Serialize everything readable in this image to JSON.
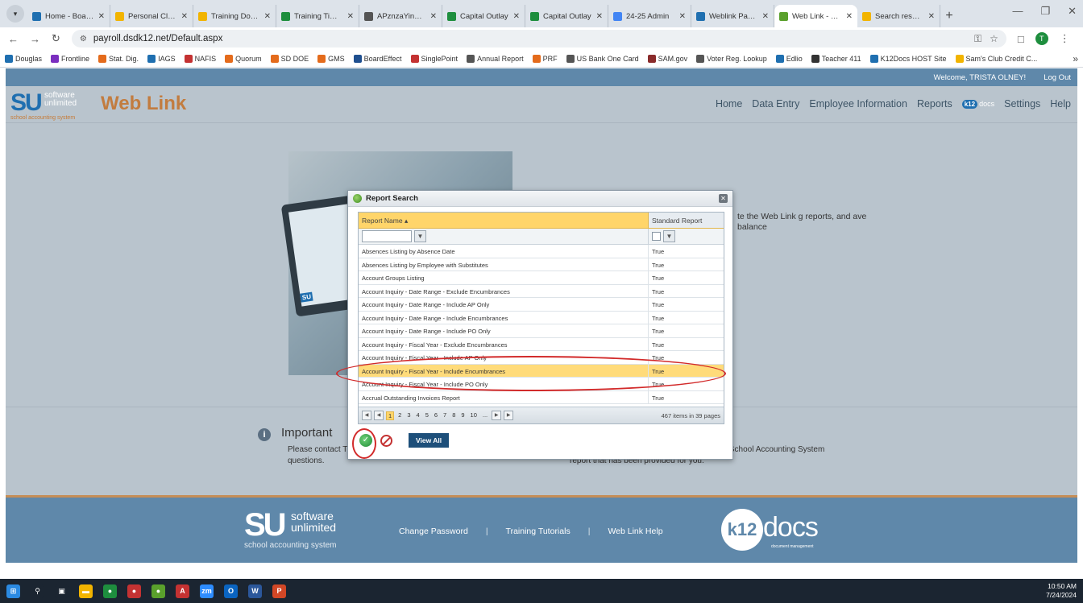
{
  "browser": {
    "tabs": [
      {
        "label": "Home - BoardDocs",
        "color": "#1f6fb0",
        "active": false
      },
      {
        "label": "Personal Cloud",
        "color": "#f2b400",
        "active": false
      },
      {
        "label": "Training Documents",
        "color": "#f2b400",
        "active": false
      },
      {
        "label": "Training Timeline",
        "color": "#1e8e3e",
        "active": false
      },
      {
        "label": "APznzaYinPaw",
        "color": "#555555",
        "active": false
      },
      {
        "label": "Capital Outlay",
        "color": "#1e8e3e",
        "active": false
      },
      {
        "label": "Capital Outlay",
        "color": "#1e8e3e",
        "active": false
      },
      {
        "label": "24-25 Admin",
        "color": "#4285f4",
        "active": false
      },
      {
        "label": "Weblink Payroll",
        "color": "#1f6fb0",
        "active": false
      },
      {
        "label": "Web Link - Home",
        "color": "#5aa02c",
        "active": true
      },
      {
        "label": "Search results",
        "color": "#f2b400",
        "active": false
      }
    ],
    "url": "payroll.dsdk12.net/Default.aspx",
    "bookmarks": [
      {
        "label": "Douglas",
        "color": "#1f6fb0"
      },
      {
        "label": "Frontline",
        "color": "#7b2fbf"
      },
      {
        "label": "Stat. Dig.",
        "color": "#e46b1c"
      },
      {
        "label": "IAGS",
        "color": "#1f6fb0"
      },
      {
        "label": "NAFIS",
        "color": "#c43232"
      },
      {
        "label": "Quorum",
        "color": "#e46b1c"
      },
      {
        "label": "SD DOE",
        "color": "#e46b1c"
      },
      {
        "label": "GMS",
        "color": "#e46b1c"
      },
      {
        "label": "BoardEffect",
        "color": "#1f4f8f"
      },
      {
        "label": "SinglePoint",
        "color": "#c43232"
      },
      {
        "label": "Annual Report",
        "color": "#555555"
      },
      {
        "label": "PRF",
        "color": "#e46b1c"
      },
      {
        "label": "US Bank One Card",
        "color": "#555555"
      },
      {
        "label": "SAM.gov",
        "color": "#8a2b2b"
      },
      {
        "label": "Voter Reg. Lookup",
        "color": "#555555"
      },
      {
        "label": "Edlio",
        "color": "#1f6fb0"
      },
      {
        "label": "Teacher 411",
        "color": "#333333"
      },
      {
        "label": "K12Docs HOST Site",
        "color": "#1f6fb0"
      },
      {
        "label": "Sam's Club Credit C...",
        "color": "#f2b400"
      }
    ]
  },
  "page": {
    "welcome": "Welcome, TRISTA OLNEY!",
    "logout": "Log Out",
    "logo": {
      "su": "SU",
      "sw_line1": "software",
      "sw_line2": "unlimited",
      "tagline": "school accounting system"
    },
    "app_title": "Web Link",
    "nav": [
      "Home",
      "Data Entry",
      "Employee Information",
      "Reports",
      "Settings",
      "Help"
    ],
    "k12_badge": {
      "k": "k12",
      "d": "docs"
    },
    "intro_text": "te the Web Link g reports, and ave balance",
    "important_title": "Important",
    "important_text": "Please contact T questions.",
    "info_right": "past requisition information, or generate any School Accounting System report that has been provided for you.",
    "footer_links": [
      "Change Password",
      "Training Tutorials",
      "Web Link Help"
    ],
    "footer_logo": {
      "su": "SU",
      "sw_line1": "software",
      "sw_line2": "unlimited",
      "tagline": "school accounting system"
    },
    "footer_k12": {
      "k": "k12",
      "docs": "docs",
      "tagline": "document management"
    },
    "tablet_label": "SU"
  },
  "dialog": {
    "title": "Report Search",
    "columns": [
      "Report Name",
      "Standard Report"
    ],
    "rows": [
      {
        "name": "Absences Listing by Absence Date",
        "standard": "True"
      },
      {
        "name": "Absences Listing by Employee with Substitutes",
        "standard": "True"
      },
      {
        "name": "Account Groups Listing",
        "standard": "True"
      },
      {
        "name": "Account Inquiry - Date Range - Exclude Encumbrances",
        "standard": "True"
      },
      {
        "name": "Account Inquiry - Date Range - Include AP Only",
        "standard": "True"
      },
      {
        "name": "Account Inquiry - Date Range - Include Encumbrances",
        "standard": "True"
      },
      {
        "name": "Account Inquiry - Date Range - Include PO Only",
        "standard": "True"
      },
      {
        "name": "Account Inquiry - Fiscal Year - Exclude Encumbrances",
        "standard": "True"
      },
      {
        "name": "Account Inquiry - Fiscal Year - Include AP Only",
        "standard": "True"
      },
      {
        "name": "Account Inquiry - Fiscal Year - Include Encumbrances",
        "standard": "True",
        "selected": true
      },
      {
        "name": "Account Inquiry - Fiscal Year - Include PO Only",
        "standard": "True"
      },
      {
        "name": "Accrual Outstanding Invoices Report",
        "standard": "True"
      }
    ],
    "pages": [
      "1",
      "2",
      "3",
      "4",
      "5",
      "6",
      "7",
      "8",
      "9",
      "10",
      "..."
    ],
    "current_page": "1",
    "count_text": "467 items in 39 pages",
    "view_all": "View All"
  },
  "taskbar": {
    "time": "10:50 AM",
    "date": "7/24/2024",
    "apps": [
      {
        "name": "windows",
        "color": "#2b8ae2",
        "glyph": "⊞"
      },
      {
        "name": "search",
        "color": "#1b2531",
        "glyph": "⚲"
      },
      {
        "name": "task-view",
        "color": "#1b2531",
        "glyph": "▣"
      },
      {
        "name": "file-explorer",
        "color": "#f2b400",
        "glyph": "▬"
      },
      {
        "name": "chrome",
        "color": "#1e8e3e",
        "glyph": "●"
      },
      {
        "name": "chrome-profile",
        "color": "#c43232",
        "glyph": "●"
      },
      {
        "name": "chrome-app",
        "color": "#5aa02c",
        "glyph": "●"
      },
      {
        "name": "acrobat",
        "color": "#c43232",
        "glyph": "A"
      },
      {
        "name": "zoom",
        "color": "#2d8cff",
        "glyph": "zm"
      },
      {
        "name": "outlook",
        "color": "#0a64c0",
        "glyph": "O"
      },
      {
        "name": "word",
        "color": "#2b579a",
        "glyph": "W"
      },
      {
        "name": "powerpoint",
        "color": "#d24726",
        "glyph": "P"
      }
    ]
  }
}
